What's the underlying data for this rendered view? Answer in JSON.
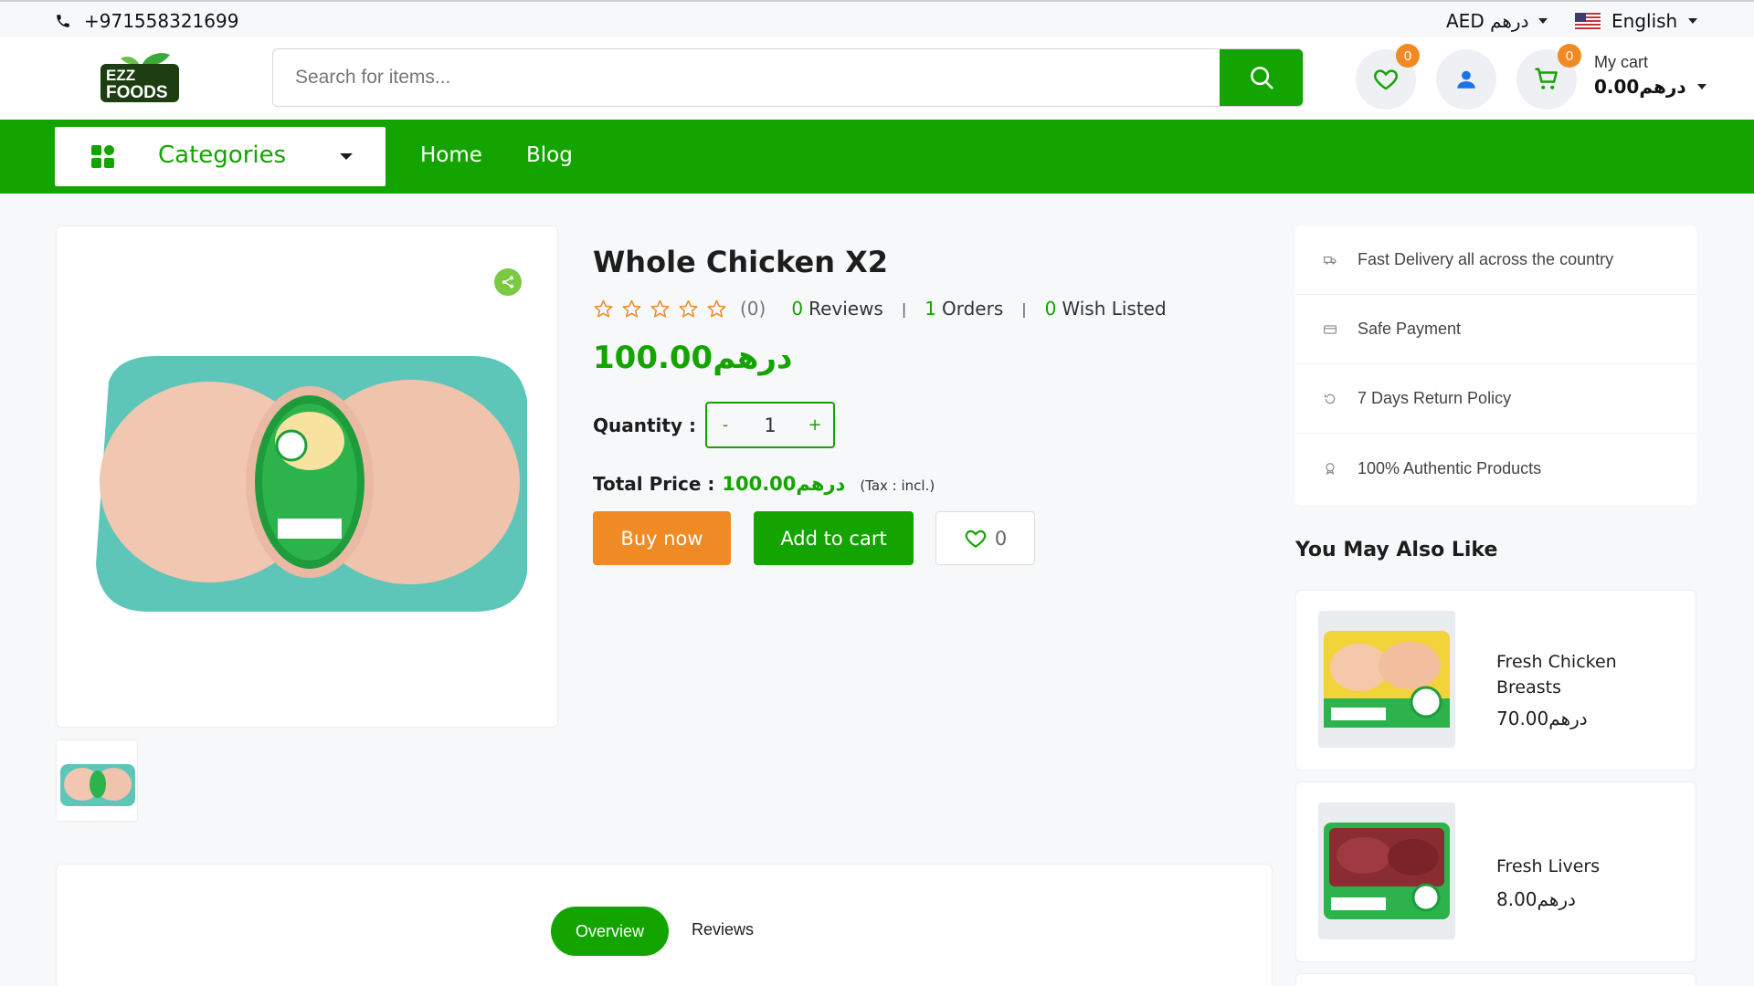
{
  "topbar": {
    "phone": "+971558321699",
    "currency": "AED درهم",
    "language": "English"
  },
  "header": {
    "logo_text_line1": "EZZ",
    "logo_text_line2": "FOODS",
    "search_placeholder": "Search for items...",
    "wishlist_count": "0",
    "cart_count": "0",
    "cart_label": "My cart",
    "cart_amount": "0.00درهم"
  },
  "nav": {
    "categories_label": "Categories",
    "links": [
      "Home",
      "Blog"
    ]
  },
  "product": {
    "title": "Whole Chicken X2",
    "rating_count": "(0)",
    "reviews_num": "0",
    "reviews_label": "Reviews",
    "orders_num": "1",
    "orders_label": "Orders",
    "wish_num": "0",
    "wish_label": "Wish Listed",
    "price": "100.00درهم",
    "quantity_label": "Quantity :",
    "quantity_value": "1",
    "qty_minus": "-",
    "qty_plus": "+",
    "total_label": "Total Price :",
    "total_value": "100.00درهم",
    "tax_note": "(Tax : incl.)",
    "buy_now": "Buy now",
    "add_to_cart": "Add to cart",
    "wish_button_count": "0"
  },
  "features": [
    {
      "icon": "truck-icon",
      "text": "Fast Delivery all across the country"
    },
    {
      "icon": "card-icon",
      "text": "Safe Payment"
    },
    {
      "icon": "return-icon",
      "text": "7 Days Return Policy"
    },
    {
      "icon": "badge-icon",
      "text": "100% Authentic Products"
    }
  ],
  "recommendations": {
    "title": "You May Also Like",
    "items": [
      {
        "name": "Fresh Chicken Breasts",
        "price": "70.00درهم"
      },
      {
        "name": "Fresh Livers",
        "price": "8.00درهم"
      }
    ]
  },
  "tabs": {
    "overview": "Overview",
    "reviews": "Reviews"
  },
  "colors": {
    "brand_green": "#14a400",
    "accent_orange": "#f08a24",
    "background": "#f7f8fa"
  }
}
